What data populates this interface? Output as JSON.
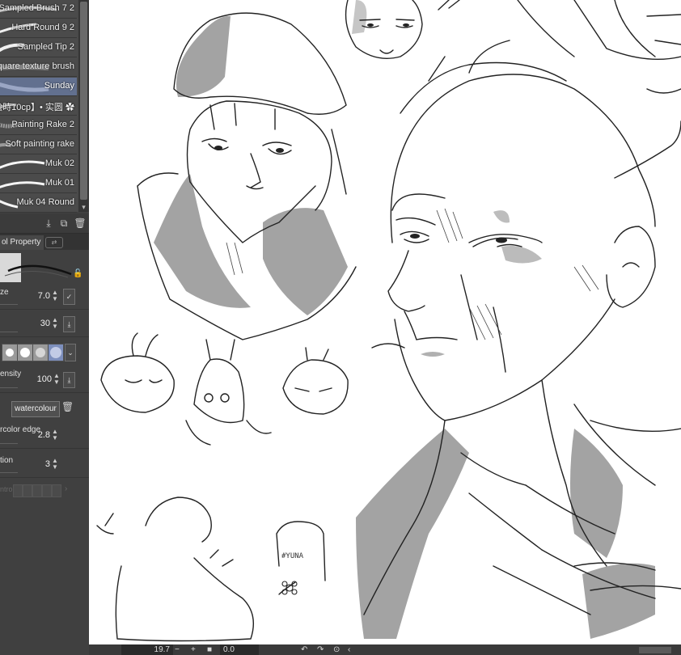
{
  "brushes": [
    {
      "name": "Sampled Brush 7 2",
      "selected": false
    },
    {
      "name": "Hard Round 9 2",
      "selected": false
    },
    {
      "name": "Sampled Tip 2",
      "selected": false
    },
    {
      "name": "quare texture brush",
      "selected": false
    },
    {
      "name": "Sunday",
      "selected": true
    },
    {
      "name": "絵時10cp】• 实圆 ✿",
      "selected": false
    },
    {
      "name": "Painting Rake 2",
      "selected": false
    },
    {
      "name": "Soft painting rake",
      "selected": false
    },
    {
      "name": "Muk 02",
      "selected": false
    },
    {
      "name": "Muk 01",
      "selected": false
    },
    {
      "name": "Muk 04 Round",
      "selected": false
    }
  ],
  "list_toolbar": {
    "icons": [
      "import-icon",
      "duplicate-icon",
      "delete-icon"
    ]
  },
  "tabs": {
    "tool_property": "ol Property"
  },
  "properties": {
    "size": {
      "label": "ze",
      "value": "7.0"
    },
    "opacity": {
      "label": "",
      "value": "30"
    },
    "density": {
      "label": "ensity",
      "value": "100"
    },
    "texture": {
      "value": "watercolour"
    },
    "watercolor_edge": {
      "label": "rcolor edge",
      "value": "2.8"
    },
    "correction": {
      "label": "tion",
      "value": "3"
    },
    "disabled_row": {
      "label": "ntrol"
    }
  },
  "status_bar": {
    "zoom": "19.7",
    "rotation": "0.0"
  },
  "canvas": {
    "signature": "#YUNA"
  },
  "colors": {
    "panel_bg": "#404040",
    "selected_brush": "#62708f",
    "canvas_bg": "#ffffff",
    "shade": "#9e9e9e"
  }
}
